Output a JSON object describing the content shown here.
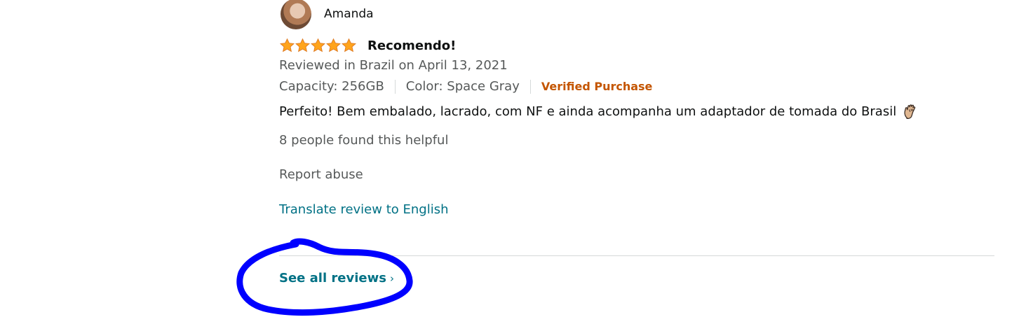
{
  "review": {
    "reviewer_name": "Amanda",
    "rating": 5,
    "rating_max": 5,
    "title": "Recomendo!",
    "date_text": "Reviewed in Brazil on April 13, 2021",
    "capacity": "Capacity: 256GB",
    "color": "Color: Space Gray",
    "verified": "Verified Purchase",
    "body": "Perfeito! Bem embalado, lacrado, com NF e ainda acompanha um adaptador de tomada do Brasil",
    "emoji_icon": "clapping-hands-icon",
    "helpful_text": "8 people found this helpful",
    "report_label": "Report abuse",
    "translate_label": "Translate review to English"
  },
  "footer": {
    "see_all_label": "See all reviews",
    "chevron": "›"
  },
  "colors": {
    "star": "#ffa41c",
    "link": "#007185",
    "verified": "#c45500",
    "secondary_text": "#565959",
    "annotation": "#0000ff"
  }
}
